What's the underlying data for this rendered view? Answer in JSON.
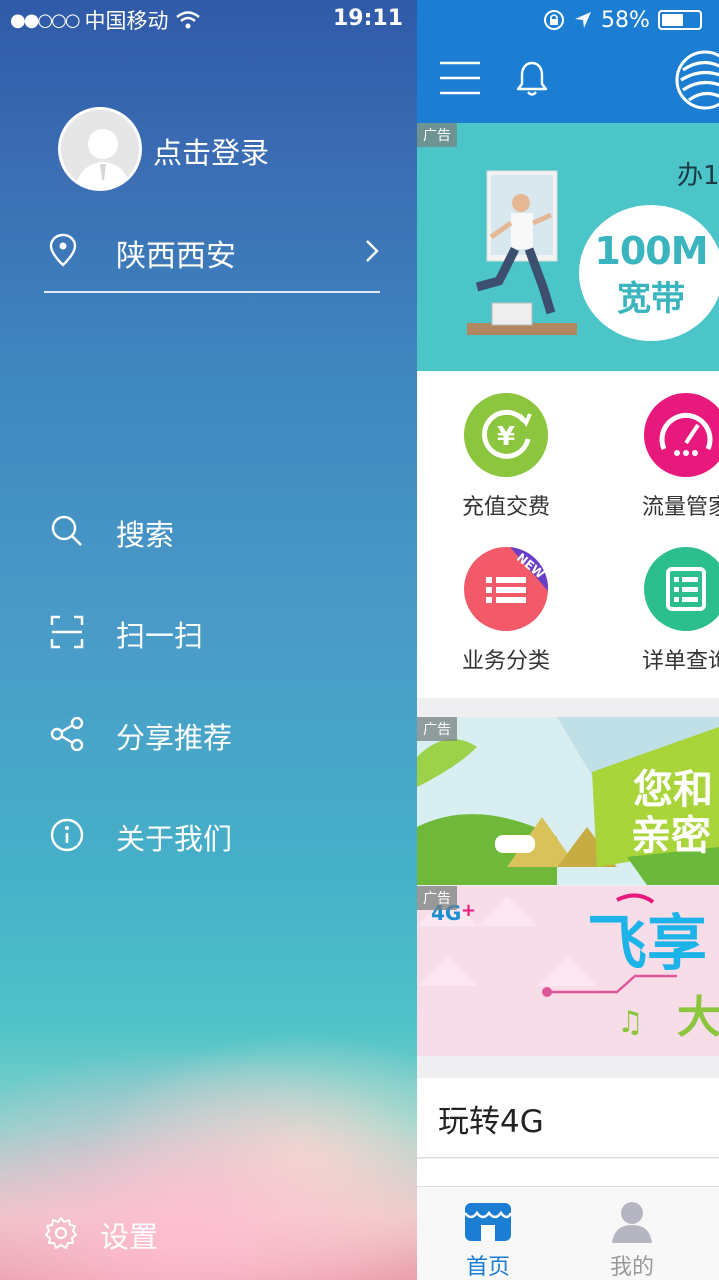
{
  "status_bar": {
    "signal": "●●○○○",
    "carrier": "中国移动",
    "time": "19:11",
    "battery": "58%",
    "battery_level": 0.58
  },
  "drawer": {
    "login_label": "点击登录",
    "location": "陕西西安",
    "menu": [
      {
        "label": "搜索",
        "icon": "search-icon"
      },
      {
        "label": "扫一扫",
        "icon": "scan-icon"
      },
      {
        "label": "分享推荐",
        "icon": "share-icon"
      },
      {
        "label": "关于我们",
        "icon": "info-icon"
      }
    ],
    "settings_label": "设置"
  },
  "main": {
    "ad_badge": "广告",
    "banner1": {
      "top_text": "办1",
      "circle_line1": "100M",
      "circle_line2": "宽带"
    },
    "quick_items": [
      {
        "label": "充值交费",
        "color": "#8cc63e"
      },
      {
        "label": "流量管家",
        "color": "#e8197d"
      },
      {
        "label": "业务分类",
        "color": "#f25a6a",
        "badge": "NEW"
      },
      {
        "label": "详单查询",
        "color": "#2dbe8e"
      }
    ],
    "banner2_text": "您和亲密",
    "banner3_text_1": "飞享",
    "banner3_text_2": "大",
    "banner3_4g": "4G+",
    "section_title": "玩转4G"
  },
  "tabbar": {
    "home": "首页",
    "mine": "我的",
    "active_color": "#1b7ed2"
  },
  "colors": {
    "header_blue": "#1b7ed2",
    "banner_teal": "#4cc5c8"
  }
}
